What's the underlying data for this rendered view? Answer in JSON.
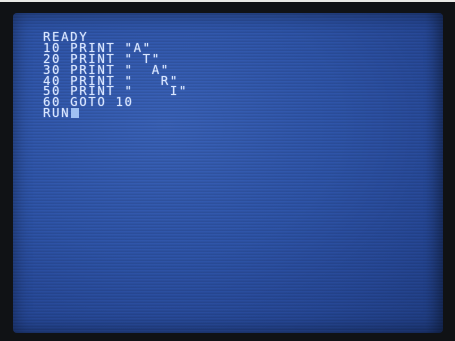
{
  "screen": {
    "lines": [
      "READY",
      "10 PRINT \"A\"",
      "20 PRINT \" T\"",
      "30 PRINT \"  A\"",
      "40 PRINT \"   R\"",
      "50 PRINT \"    I\"",
      "60 GOTO 10",
      "RUN"
    ]
  },
  "colors": {
    "screen_background": "#2e54a8",
    "text": "#d9e6ff",
    "cursor": "#9fc0f2",
    "bezel": "#101215"
  }
}
